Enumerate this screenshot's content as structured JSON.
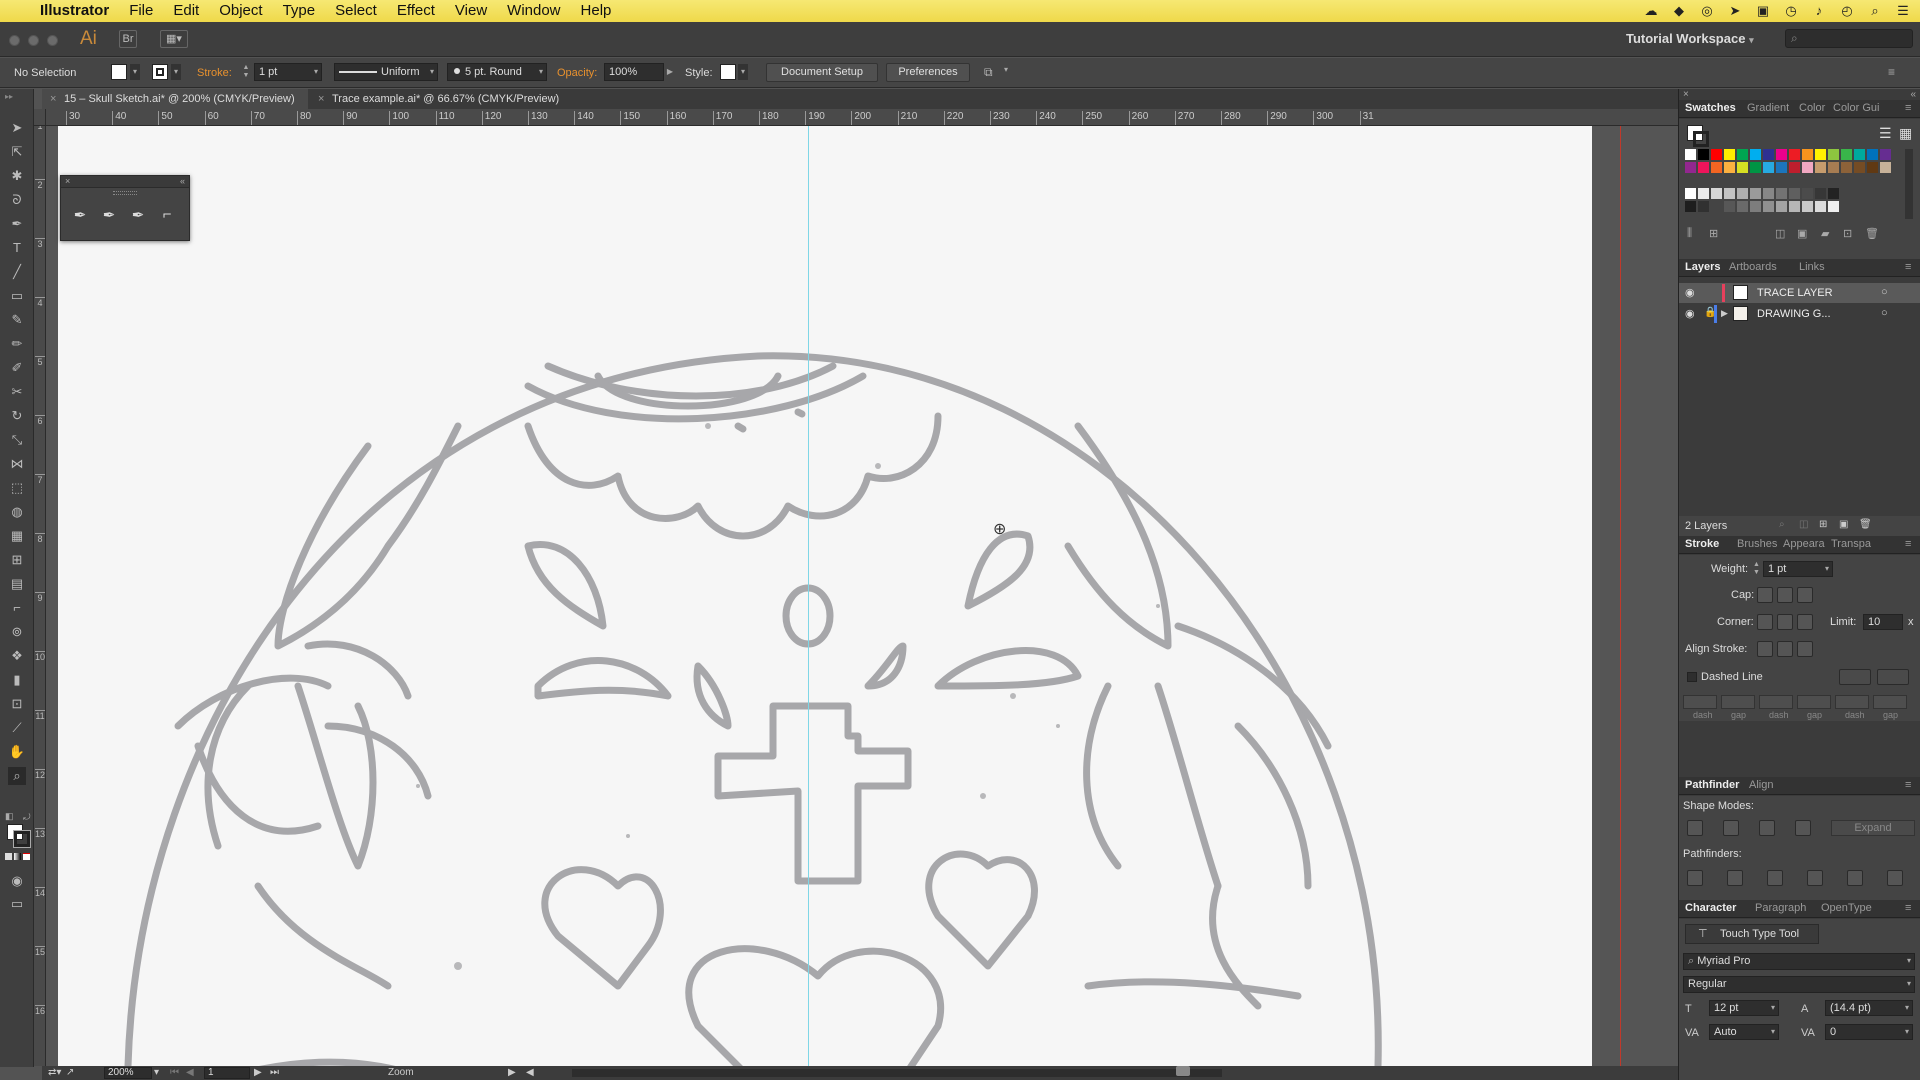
{
  "menubar": {
    "app": "Illustrator",
    "items": [
      "File",
      "Edit",
      "Object",
      "Type",
      "Select",
      "Effect",
      "View",
      "Window",
      "Help"
    ]
  },
  "appbar": {
    "logo": "Ai",
    "bridge": "Br",
    "workspace": "Tutorial Workspace"
  },
  "control": {
    "selection": "No Selection",
    "stroke_label": "Stroke:",
    "stroke_value": "1 pt",
    "profile": "Uniform",
    "brush": "5 pt. Round",
    "opacity_label": "Opacity:",
    "opacity_value": "100%",
    "style_label": "Style:",
    "doc_setup": "Document Setup",
    "preferences": "Preferences"
  },
  "tabs": [
    {
      "label": "15 – Skull Sketch.ai* @ 200% (CMYK/Preview)"
    },
    {
      "label": "Trace example.ai* @ 66.67% (CMYK/Preview)"
    }
  ],
  "ruler_top": [
    "30",
    "40",
    "50",
    "60",
    "70",
    "80",
    "90",
    "100",
    "110",
    "120",
    "130",
    "140",
    "150",
    "160",
    "170",
    "180",
    "190",
    "200",
    "210",
    "220",
    "230",
    "240",
    "250",
    "260",
    "270",
    "280",
    "290",
    "300",
    "31"
  ],
  "ruler_left": [
    "1",
    "2",
    "3",
    "4",
    "5",
    "6",
    "7",
    "8",
    "9",
    "10",
    "11",
    "12",
    "13",
    "14",
    "15",
    "16"
  ],
  "status": {
    "zoom": "200%",
    "artboard": "1",
    "tool": "Zoom"
  },
  "swatches_panel": {
    "tabs": [
      "Swatches",
      "Gradient",
      "Color",
      "Color Gui"
    ],
    "colors": [
      "#ffffff",
      "#000000",
      "#ff0000",
      "#ffed00",
      "#00a651",
      "#00aeef",
      "#2e3192",
      "#ec008c",
      "#ed1c24",
      "#f7941d",
      "#fff200",
      "#8dc63f",
      "#39b54a",
      "#00a99d",
      "#0072bc",
      "#662d91",
      "#92278f",
      "#ed145b",
      "#f26522",
      "#fbb040",
      "#d7df23",
      "#009444",
      "#27aae1",
      "#1b75bc",
      "#be1e2d",
      "#f1a7c1",
      "#c69c6d",
      "#a67c52",
      "#8c6239",
      "#754c24",
      "#603913",
      "#c7b299"
    ]
  },
  "layers_panel": {
    "tabs": [
      "Layers",
      "Artboards",
      "Links"
    ],
    "layers": [
      {
        "name": "TRACE LAYER",
        "color": "#e8405c"
      },
      {
        "name": "DRAWING G...",
        "color": "#4a7de8"
      }
    ],
    "count": "2 Layers"
  },
  "stroke_panel": {
    "tabs": [
      "Stroke",
      "Brushes",
      "Appeara",
      "Transpa"
    ],
    "weight_label": "Weight:",
    "weight": "1 pt",
    "cap_label": "Cap:",
    "corner_label": "Corner:",
    "limit_label": "Limit:",
    "limit": "10",
    "limit_unit": "x",
    "align_label": "Align Stroke:",
    "dashed_label": "Dashed Line",
    "dash_labels": [
      "dash",
      "gap",
      "dash",
      "gap",
      "dash",
      "gap"
    ]
  },
  "pathfinder_panel": {
    "tabs": [
      "Pathfinder",
      "Align"
    ],
    "shape_modes": "Shape Modes:",
    "expand": "Expand",
    "pathfinders": "Pathfinders:"
  },
  "character_panel": {
    "tabs": [
      "Character",
      "Paragraph",
      "OpenType"
    ],
    "touch_type": "Touch Type Tool",
    "font": "Myriad Pro",
    "style": "Regular",
    "size": "12 pt",
    "leading": "(14.4 pt)",
    "kerning": "Auto",
    "tracking": "0"
  }
}
